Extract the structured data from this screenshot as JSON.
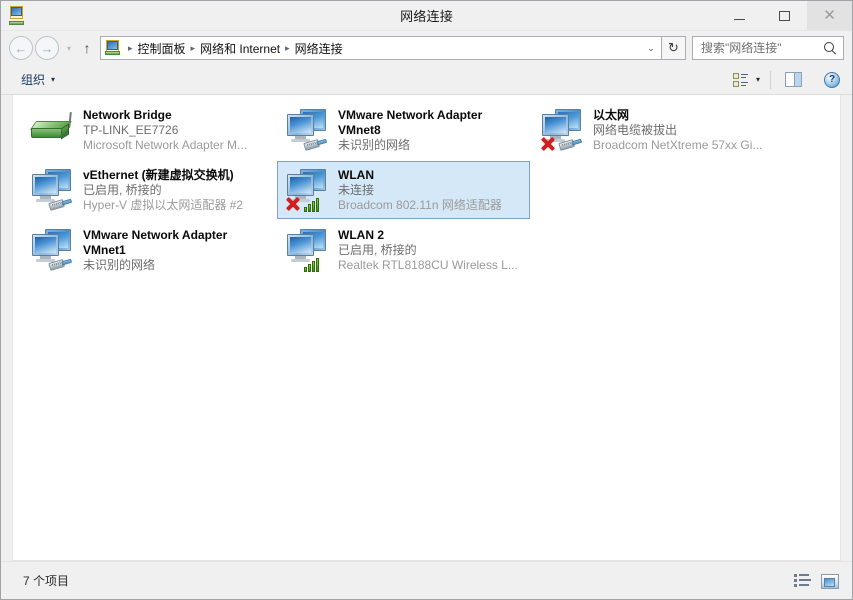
{
  "window": {
    "title": "网络连接",
    "app_icon": "network-connections-icon",
    "minimize_label": "最小化",
    "maximize_label": "最大化",
    "close_label": "关闭"
  },
  "address_bar": {
    "back_label": "←",
    "forward_label": "→",
    "history_caret": "▾",
    "up_label": "↑",
    "icon": "control-panel-network-icon",
    "crumbs": [
      "控制面板",
      "网络和 Internet",
      "网络连接"
    ],
    "separator": "▸",
    "dropdown_caret": "⌄",
    "refresh_label": "↻"
  },
  "search": {
    "placeholder": "搜索\"网络连接\"",
    "value": "",
    "icon": "search-icon"
  },
  "toolbar": {
    "organize_label": "组织",
    "organize_caret": "▾",
    "view_options_caret": "▾",
    "view_options_icon": "change-view-icon",
    "preview_pane_icon": "preview-pane-icon",
    "help_icon": "help-icon",
    "help_glyph": "?"
  },
  "connections": [
    {
      "name": "Network Bridge",
      "status": "TP-LINK_EE7726",
      "device": "Microsoft Network Adapter M...",
      "icon": "network-bridge-icon",
      "selected": false,
      "has_error": false,
      "has_signal": false,
      "has_plug": false
    },
    {
      "name": "vEthernet (新建虚拟交换机)",
      "status": "已启用, 桥接的",
      "device": "Hyper-V 虚拟以太网适配器 #2",
      "icon": "ethernet-adapter-icon",
      "selected": false,
      "has_error": false,
      "has_signal": false,
      "has_plug": true
    },
    {
      "name": "VMware Network Adapter VMnet1",
      "status": "未识别的网络",
      "device": "",
      "icon": "ethernet-adapter-icon",
      "selected": false,
      "has_error": false,
      "has_signal": false,
      "has_plug": true
    },
    {
      "name": "VMware Network Adapter VMnet8",
      "status": "未识别的网络",
      "device": "",
      "icon": "ethernet-adapter-icon",
      "selected": false,
      "has_error": false,
      "has_signal": false,
      "has_plug": true
    },
    {
      "name": "WLAN",
      "status": "未连接",
      "device": "Broadcom 802.11n 网络适配器",
      "icon": "wireless-adapter-icon",
      "selected": true,
      "has_error": true,
      "has_signal": true,
      "has_plug": false
    },
    {
      "name": "WLAN 2",
      "status": "已启用, 桥接的",
      "device": "Realtek RTL8188CU Wireless L...",
      "icon": "wireless-adapter-icon",
      "selected": false,
      "has_error": false,
      "has_signal": true,
      "has_plug": false
    },
    {
      "name": "以太网",
      "status": "网络电缆被拔出",
      "device": "Broadcom NetXtreme 57xx Gi...",
      "icon": "ethernet-adapter-icon",
      "selected": false,
      "has_error": true,
      "has_signal": false,
      "has_plug": true
    }
  ],
  "status_bar": {
    "item_count_text": "7 个项目",
    "details_view_icon": "details-view-icon",
    "large_icons_view_icon": "large-icons-view-icon"
  }
}
